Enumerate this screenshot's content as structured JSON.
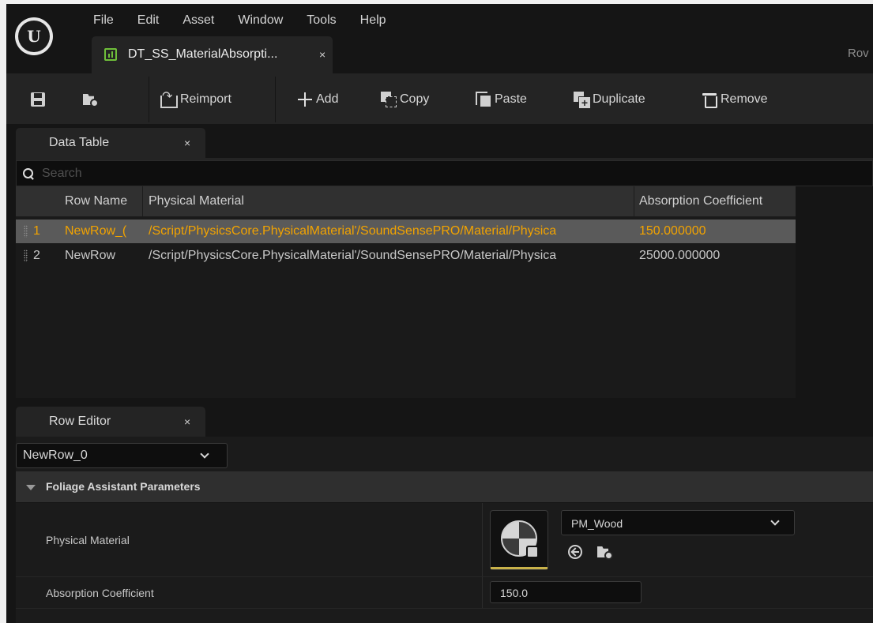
{
  "menu": [
    "File",
    "Edit",
    "Asset",
    "Window",
    "Tools",
    "Help"
  ],
  "asset_tab": {
    "label": "DT_SS_MaterialAbsorpti...",
    "close": "×"
  },
  "right_edge_text": "Rov",
  "toolbar": {
    "reimport": "Reimport",
    "add": "Add",
    "copy": "Copy",
    "paste": "Paste",
    "duplicate": "Duplicate",
    "remove": "Remove"
  },
  "data_table_panel": {
    "tab_label": "Data Table",
    "close": "×",
    "search_placeholder": "Search",
    "columns": [
      "Row Name",
      "Physical Material",
      "Absorption Coefficient"
    ],
    "rows": [
      {
        "index": "1",
        "name": "NewRow_(",
        "material": "/Script/PhysicsCore.PhysicalMaterial'/SoundSensePRO/Material/Physica",
        "coefficient": "150.000000",
        "selected": true
      },
      {
        "index": "2",
        "name": "NewRow",
        "material": "/Script/PhysicsCore.PhysicalMaterial'/SoundSensePRO/Material/Physica",
        "coefficient": "25000.000000",
        "selected": false
      }
    ]
  },
  "row_editor_panel": {
    "tab_label": "Row Editor",
    "close": "×",
    "selected_row": "NewRow_0",
    "category": "Foliage Assistant Parameters",
    "physical_material_label": "Physical Material",
    "physical_material_value": "PM_Wood",
    "absorption_label": "Absorption Coefficient",
    "absorption_value": "150.0"
  },
  "colors": {
    "background": "#151515",
    "panel": "#242424",
    "selected_row_text": "#f2a300",
    "datatable_icon": "#6fbf3a"
  }
}
